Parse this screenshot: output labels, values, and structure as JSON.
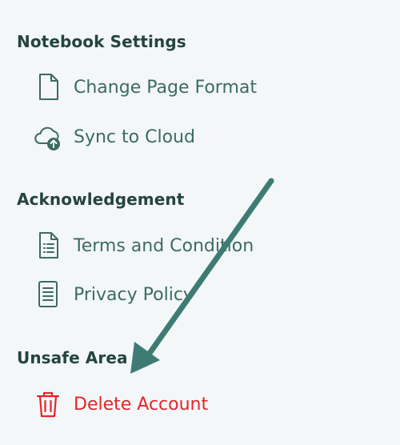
{
  "sections": [
    {
      "title": "Notebook Settings",
      "items": [
        {
          "label": "Change Page Format",
          "icon": "page-icon"
        },
        {
          "label": "Sync to Cloud",
          "icon": "cloud-upload-icon"
        }
      ]
    },
    {
      "title": "Acknowledgement",
      "items": [
        {
          "label": "Terms and Condition",
          "icon": "document-list-icon"
        },
        {
          "label": "Privacy Policy",
          "icon": "document-lines-icon"
        }
      ]
    },
    {
      "title": "Unsafe Area",
      "items": [
        {
          "label": "Delete Account",
          "icon": "trash-icon"
        }
      ]
    }
  ],
  "colors": {
    "background": "#f3f7f8",
    "heading": "#24443d",
    "item_text": "#3d6b62",
    "danger": "#e5252a",
    "annotation_arrow": "#3f7b75"
  }
}
